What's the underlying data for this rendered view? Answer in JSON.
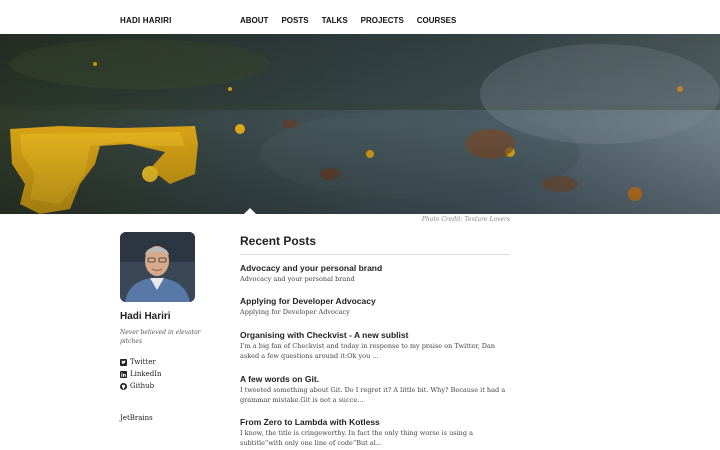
{
  "header": {
    "brand": "HADI HARIRI",
    "nav": [
      "ABOUT",
      "POSTS",
      "TALKS",
      "PROJECTS",
      "COURSES"
    ]
  },
  "hero": {
    "credit": "Photo Credit: Texture Lovers"
  },
  "sidebar": {
    "name": "Hadi Hariri",
    "tagline": "Never believed in elevator pitches",
    "links": [
      {
        "label": "Twitter",
        "icon": "twitter-icon"
      },
      {
        "label": "LinkedIn",
        "icon": "linkedin-icon"
      },
      {
        "label": "Github",
        "icon": "github-icon"
      }
    ],
    "company": "JetBrains"
  },
  "main": {
    "heading": "Recent Posts",
    "posts": [
      {
        "title": "Advocacy and your personal brand",
        "excerpt": "Advocacy and your personal brand"
      },
      {
        "title": "Applying for Developer Advocacy",
        "excerpt": "Applying for Developer Advocacy"
      },
      {
        "title": "Organising with Checkvist - A new sublist",
        "excerpt": "I’m a big fan of Checkvist and today in response to my praise on Twitter, Dan asked a few questions around it:Ok you ..."
      },
      {
        "title": "A few words on Git.",
        "excerpt": "I tweeted something about Git. Do I regret it? A little bit. Why? Because it had a grammar mistake.Git is not a succe..."
      },
      {
        "title": "From Zero to Lambda with Kotless",
        "excerpt": "I know, the title is cringeworthy. In fact the only thing worse is using a subtitle“with only one line of code”But al..."
      }
    ]
  }
}
